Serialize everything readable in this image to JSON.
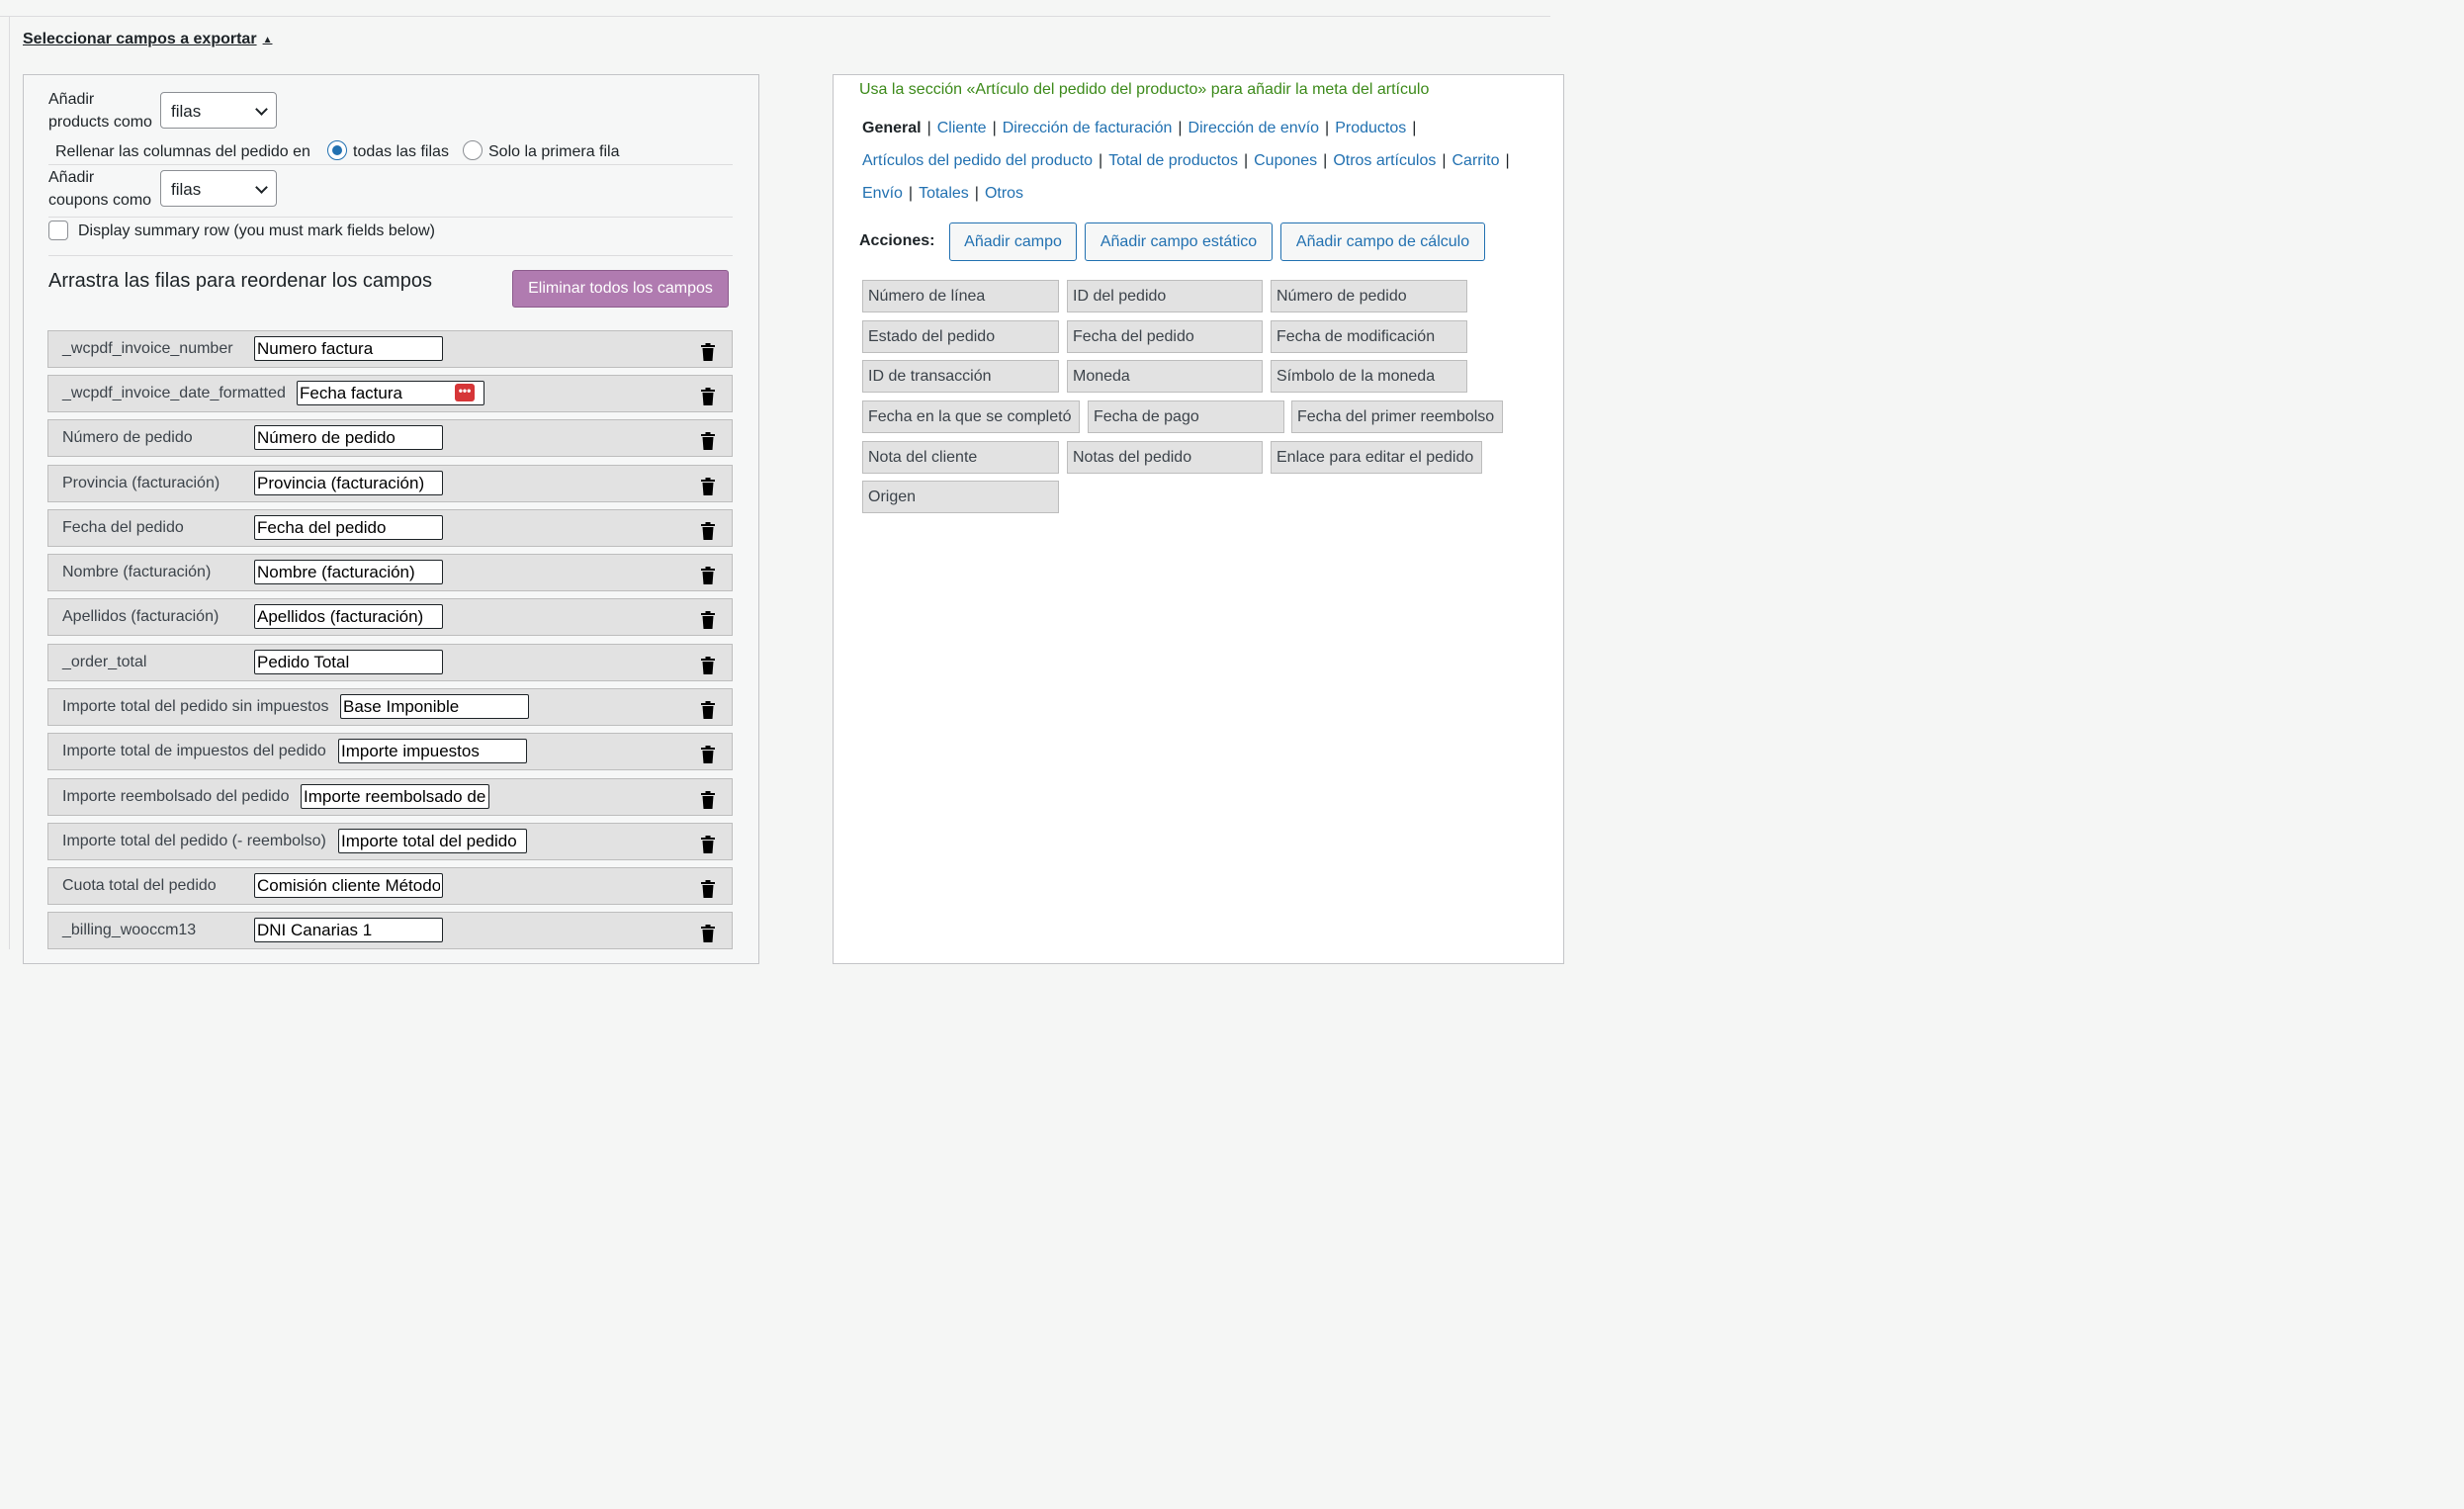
{
  "section_toggle": "Seleccionar campos a exportar",
  "options": {
    "products_label_1": "Añadir",
    "products_label_2": "products como",
    "products_value": "filas",
    "fill_label": "Rellenar las columnas del pedido en",
    "fill_option_all": "todas las filas",
    "fill_option_first": "Solo la primera fila",
    "coupons_label_1": "Añadir",
    "coupons_label_2": "coupons como",
    "coupons_value": "filas",
    "summary_row_label": "Display summary row (you must mark fields below)"
  },
  "drag_title": "Arrastra las filas para reordenar los campos",
  "clear_button": "Eliminar todos los campos",
  "fields": [
    {
      "name": "_wcpdf_invoice_number",
      "value": "Numero factura"
    },
    {
      "name": "_wcpdf_invoice_date_formatted",
      "value": "Fecha factura"
    },
    {
      "name": "Número de pedido",
      "value": "Número de pedido"
    },
    {
      "name": "Provincia (facturación)",
      "value": "Provincia (facturación)"
    },
    {
      "name": "Fecha del pedido",
      "value": "Fecha del pedido"
    },
    {
      "name": "Nombre (facturación)",
      "value": "Nombre (facturación)"
    },
    {
      "name": "Apellidos (facturación)",
      "value": "Apellidos (facturación)"
    },
    {
      "name": "_order_total",
      "value": "Pedido Total"
    },
    {
      "name": "Importe total del pedido sin impuestos",
      "value": "Base Imponible"
    },
    {
      "name": "Importe total de impuestos del pedido",
      "value": "Importe impuestos"
    },
    {
      "name": "Importe reembolsado del pedido",
      "value": "Importe reembolsado de"
    },
    {
      "name": "Importe total del pedido (- reembolso)",
      "value": "Importe total del pedido"
    },
    {
      "name": "Cuota total del pedido",
      "value": "Comisión cliente Método"
    },
    {
      "name": "_billing_wooccm13",
      "value": "DNI Canarias 1"
    }
  ],
  "hint": "Usa la sección «Artículo del pedido del producto» para añadir la meta del artículo",
  "tabs": [
    "General",
    "Cliente",
    "Dirección de facturación",
    "Dirección de envío",
    "Productos",
    "Artículos del pedido del producto",
    "Total de productos",
    "Cupones",
    "Otros artículos",
    "Carrito",
    "Envío",
    "Totales",
    "Otros"
  ],
  "actions": {
    "label": "Acciones:",
    "add_field": "Añadir campo",
    "add_static": "Añadir campo estático",
    "add_calc": "Añadir campo de cálculo"
  },
  "available_fields": [
    "Número de línea",
    "ID del pedido",
    "Número de pedido",
    "Estado del pedido",
    "Fecha del pedido",
    "Fecha de modificación",
    "ID de transacción",
    "Moneda",
    "Símbolo de la moneda",
    "Fecha en la que se completó",
    "Fecha de pago",
    "Fecha del primer reembolso",
    "Nota del cliente",
    "Notas del pedido",
    "Enlace para editar el pedido",
    "Origen"
  ],
  "icons": {
    "trash": "trash-icon",
    "caret": "caret-up-icon",
    "chevron": "chevron-down-icon",
    "password_manager": "password-manager-icon"
  }
}
